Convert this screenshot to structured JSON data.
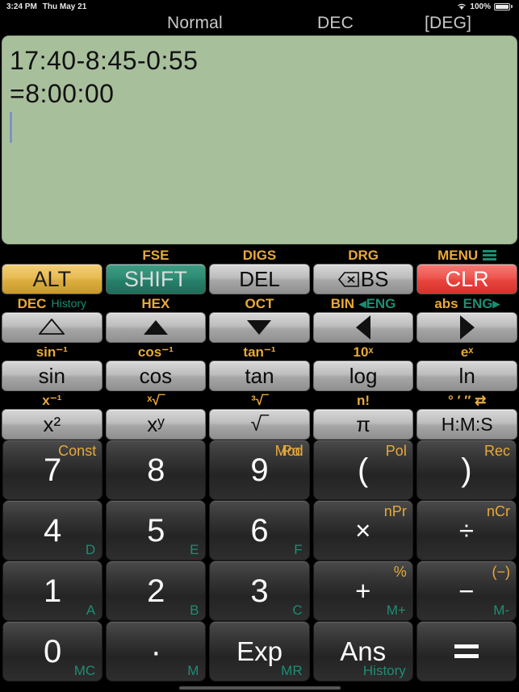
{
  "status_bar": {
    "time": "3:24 PM",
    "date": "Thu May 21",
    "battery_percent": "100%",
    "wifi_icon": "wifi-icon",
    "battery_icon": "battery-full-icon"
  },
  "mode_bar": {
    "mode": "Normal",
    "base": "DEC",
    "angle": "[DEG]"
  },
  "display": {
    "line1": "17:40-8:45-0:55",
    "line2": "=8:00:00",
    "cursor_visible": true,
    "background_color": "#a8bf9c"
  },
  "colors": {
    "gold": "#e8a93a",
    "teal": "#1c8e74",
    "alt_key": "#e8bc54",
    "shift_key": "#2f8c74",
    "clear_key": "#ee5750",
    "display_bg": "#a8bf9c"
  },
  "action_row": {
    "labels": [
      "",
      "FSE",
      "DIGS",
      "DRG",
      "MENU"
    ],
    "menu_icon": "hamburger-menu-icon",
    "keys": [
      {
        "label": "ALT"
      },
      {
        "label": "SHIFT"
      },
      {
        "label": "DEL"
      },
      {
        "label": "BS",
        "icon": "backspace-icon"
      },
      {
        "label": "CLR"
      }
    ]
  },
  "arrow_row": {
    "labels": [
      {
        "primary": "DEC",
        "secondary": "History"
      },
      {
        "primary": "HEX",
        "secondary": ""
      },
      {
        "primary": "OCT",
        "secondary": ""
      },
      {
        "primary": "BIN",
        "secondary": "◂ENG"
      },
      {
        "primary": "abs",
        "secondary": "ENG▸"
      }
    ],
    "keys": [
      {
        "icon": "triangle-outline-up-icon"
      },
      {
        "icon": "triangle-up-icon"
      },
      {
        "icon": "triangle-down-icon"
      },
      {
        "icon": "triangle-left-icon"
      },
      {
        "icon": "triangle-right-icon"
      }
    ]
  },
  "trig_row": {
    "labels": [
      "sin⁻¹",
      "cos⁻¹",
      "tan⁻¹",
      "10ˣ",
      "eˣ"
    ],
    "keys": [
      "sin",
      "cos",
      "tan",
      "log",
      "ln"
    ]
  },
  "power_row": {
    "labels": [
      "x⁻¹",
      "ˣ√‾",
      "³√‾",
      "n!",
      "° ′ ″ ⇄"
    ],
    "keys": [
      "x²",
      "xʸ",
      "√‾",
      "π",
      "H:M:S"
    ]
  },
  "keypad": [
    [
      {
        "main": "7",
        "alt": "Const",
        "mem": ""
      },
      {
        "main": "8",
        "alt": "",
        "mem": ""
      },
      {
        "main": "9",
        "alt": "Mod",
        "mem": ""
      },
      {
        "main": "(",
        "alt": "Pol",
        "mem": ""
      },
      {
        "main": ")",
        "alt": "Rec",
        "mem": ""
      }
    ],
    [
      {
        "main": "4",
        "alt": "",
        "mem": "D"
      },
      {
        "main": "5",
        "alt": "",
        "mem": "E"
      },
      {
        "main": "6",
        "alt": "",
        "mem": "F"
      },
      {
        "main": "×",
        "alt": "nPr",
        "mem": ""
      },
      {
        "main": "÷",
        "alt": "nCr",
        "mem": ""
      }
    ],
    [
      {
        "main": "1",
        "alt": "",
        "mem": "A"
      },
      {
        "main": "2",
        "alt": "",
        "mem": "B"
      },
      {
        "main": "3",
        "alt": "",
        "mem": "C"
      },
      {
        "main": "+",
        "alt": "%",
        "mem": "M+"
      },
      {
        "main": "−",
        "alt": "(−)",
        "mem": "M-"
      }
    ],
    [
      {
        "main": "0",
        "alt": "",
        "mem": "MC"
      },
      {
        "main": "·",
        "alt": "",
        "mem": "M"
      },
      {
        "main": "Exp",
        "alt": "",
        "mem": "MR"
      },
      {
        "main": "Ans",
        "alt": "",
        "mem": "History"
      },
      {
        "main": "=",
        "alt": "",
        "mem": ""
      }
    ]
  ]
}
